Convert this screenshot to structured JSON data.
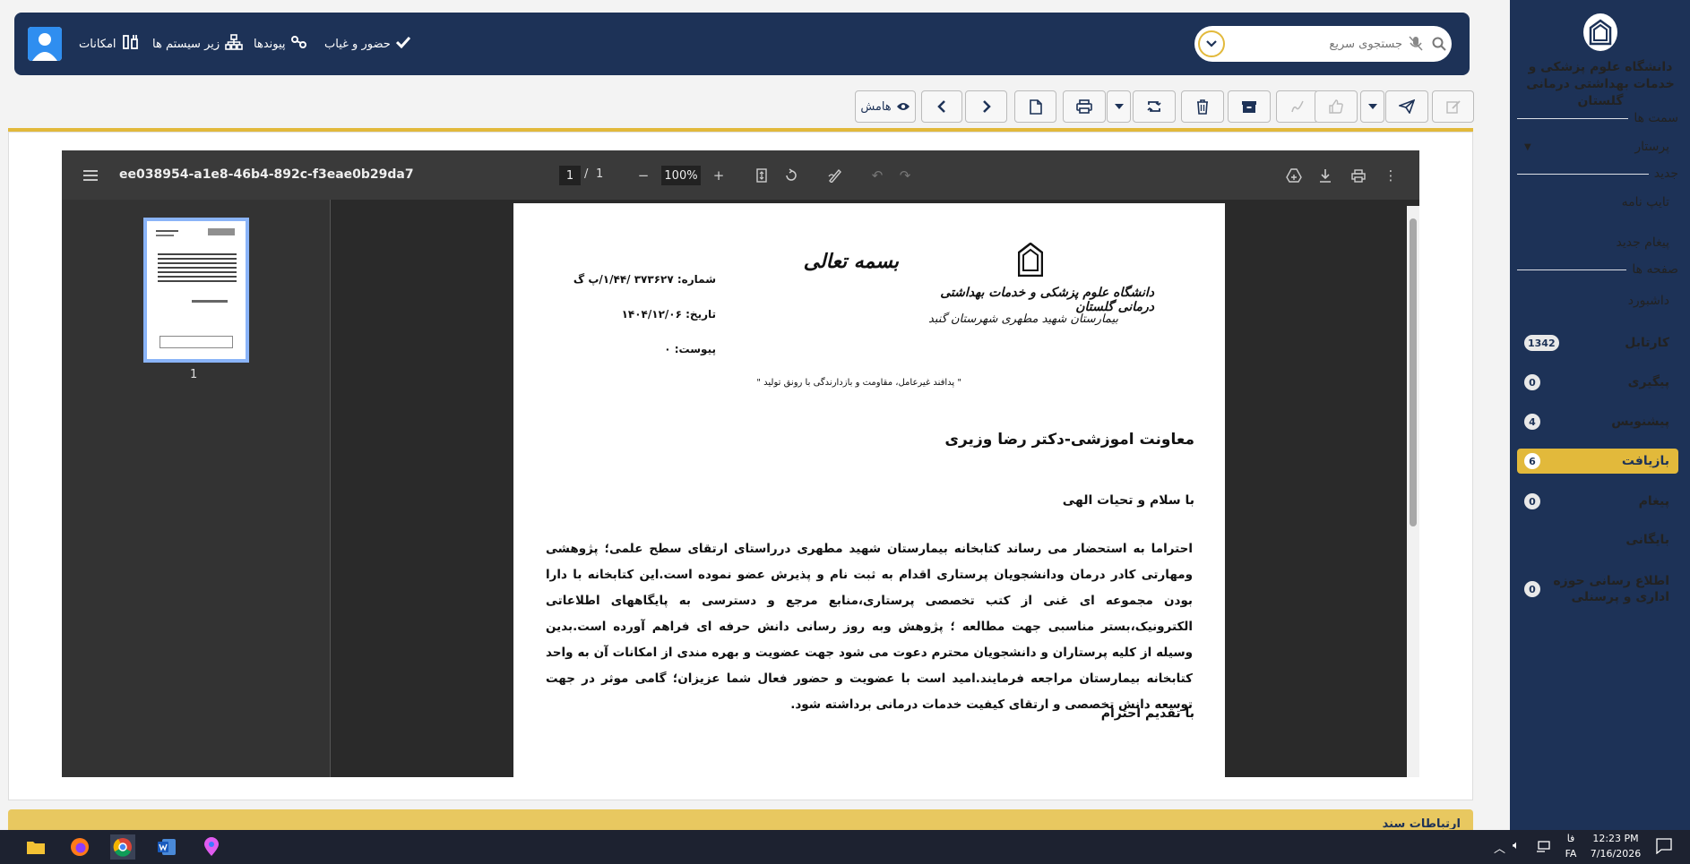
{
  "sidebar": {
    "org_name": "دانشگاه علوم پزشکی و خدمات بهداشتی درمانی گلستان",
    "sections": {
      "posts": "سمت ها",
      "new": "جدید",
      "pages": "صفحه ها"
    },
    "role": "پرستار",
    "new_items": [
      "تایپ نامه",
      "پیغام جدید"
    ],
    "items": [
      {
        "label": "داشبورد",
        "badge": ""
      },
      {
        "label": "کارتابل",
        "badge": "1342"
      },
      {
        "label": "پیگیری",
        "badge": "0"
      },
      {
        "label": "پیشنویس",
        "badge": "4"
      },
      {
        "label": "بازیافت",
        "badge": "6"
      },
      {
        "label": "پیغام",
        "badge": "0"
      },
      {
        "label": "بایگانی",
        "badge": ""
      },
      {
        "label": "اطلاع رسانی حوزه اداری و پرسنلی",
        "badge": "0"
      }
    ],
    "active_index": 4
  },
  "topnav": {
    "links": [
      "امکانات",
      "زیر سیستم ها",
      "پیوندها",
      "حضور و غیاب"
    ],
    "search_placeholder": "جستجوی سریع"
  },
  "toolbar": {
    "hamesh_label": "هامش"
  },
  "pdf": {
    "title": "ee038954-a1e8-46b4-892c-f3eae0b29da7",
    "page_current": "1",
    "page_sep": "/",
    "page_total": "1",
    "zoom": "100%",
    "thumb_label": "1"
  },
  "document": {
    "bismillah": "بسمه تعالی",
    "header_line1": "دانشگاه علوم پزشکی و خدمات بهداشتی درمانی گلستان",
    "header_line2": "بیمارستان شهید مطهری شهرستان گنبد",
    "number": "شماره:  ۳۷۳۶۲۷ /۱/۴۴/پ گ",
    "date": "تاریخ: ۱۴۰۴/۱۲/۰۶",
    "attachment": "پیوست: ۰",
    "slogan": "\" پدافند غیرعامل، مقاومت و بازدارندگی با رونق تولید \"",
    "recipient": "معاونت اموزشی-دکتر رضا وزیری",
    "greeting": "با سلام و تحیات الهی",
    "body": "احتراما به استحضار می رساند کتابخانه بیمارستان شهید مطهری درراستای ارتقای سطح علمی؛ پژوهشی ومهارتی کادر درمان ودانشجویان پرستاری اقدام به ثبت نام و پذیرش عضو نموده است.این کتابخانه با دارا بودن مجموعه ای غنی از کتب تخصصی پرستاری،منابع مرجع و دسترسی به پایگاههای اطلاعاتی الکترونیک،بستر مناسبی جهت مطالعه ؛ پژوهش وبه روز رسانی دانش حرفه ای فراهم آورده است.بدین وسیله از کلیه پرستاران و دانشجویان محترم دعوت می شود جهت عضویت و بهره مندی از امکانات آن به واحد کتابخانه بیمارستان مراجعه فرمایند.امید است با عضویت و حضور فعال شما عزیزان؛ گامی موثر در جهت توسعه دانش تخصصی و ارتقای کیفیت خدمات درمانی برداشته شود.",
    "closing": "با تقدیم احترام"
  },
  "footer": {
    "label": "ارتباطات سند"
  },
  "taskbar": {
    "lang1": "فا",
    "lang2": "FA",
    "time": "12:23 PM",
    "date": "7/16/2026"
  },
  "colors": {
    "navy": "#1d3257",
    "gold": "#e2b93b"
  }
}
